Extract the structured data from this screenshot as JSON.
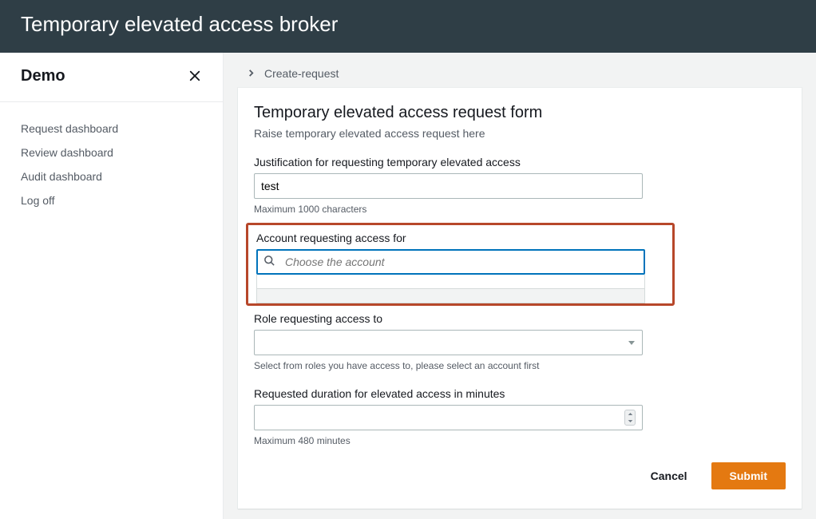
{
  "app_title": "Temporary elevated access broker",
  "sidebar": {
    "title": "Demo",
    "items": [
      {
        "label": "Request dashboard"
      },
      {
        "label": "Review dashboard"
      },
      {
        "label": "Audit dashboard"
      },
      {
        "label": "Log off"
      }
    ]
  },
  "breadcrumb": {
    "current": "Create-request"
  },
  "form": {
    "title": "Temporary elevated access request form",
    "subtitle": "Raise temporary elevated access request here",
    "justification": {
      "label": "Justification for requesting temporary elevated access",
      "value": "test",
      "hint": "Maximum 1000 characters"
    },
    "account": {
      "label": "Account requesting access for",
      "placeholder": "Choose the account"
    },
    "role": {
      "label": "Role requesting access to",
      "hint": "Select from roles you have access to, please select an account first"
    },
    "duration": {
      "label": "Requested duration for elevated access in minutes",
      "hint": "Maximum 480 minutes"
    },
    "cancel_label": "Cancel",
    "submit_label": "Submit"
  }
}
